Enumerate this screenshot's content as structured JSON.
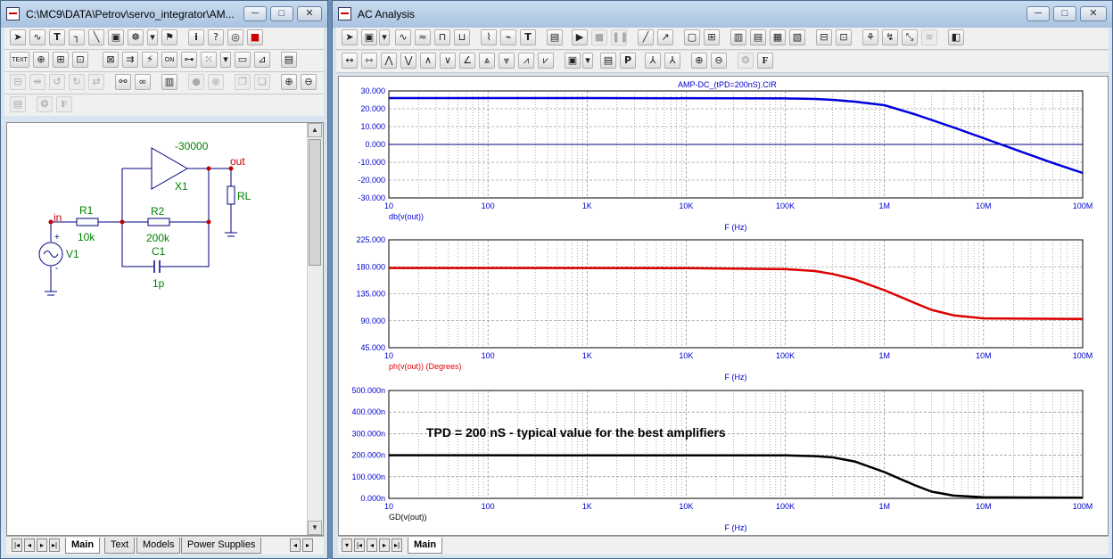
{
  "schematic_window": {
    "title": "C:\\MC9\\DATA\\Petrov\\servo_integrator\\AM...",
    "toolbar1": [
      "select-arrow",
      "wire",
      "text",
      "wire-orthogonal",
      "diagonal-line",
      "component",
      "info-tag",
      "probe",
      "flag",
      "info",
      "help",
      "plot",
      "stop-sim"
    ],
    "toolbar2": [
      "TEXT",
      "pin-connection",
      "grid-text",
      "attribute",
      "node-numbers",
      "current-flow",
      "power",
      "on-off",
      "pin-markers",
      "grid-dots",
      "dropdown",
      "border",
      "title-block",
      "properties"
    ],
    "toolbar3": [
      "rotate",
      "flip-x",
      "flip-y",
      "mirror",
      "find",
      "binoculars",
      "page-setup",
      "clear",
      "delete",
      "copy",
      "paste",
      "zoom-in",
      "zoom-out"
    ],
    "toolbar4": [
      "print-preview",
      "palette",
      "font-F"
    ],
    "labels": {
      "opamp_gain": "-30000",
      "opamp_name": "X1",
      "node_out": "out",
      "node_in": "in",
      "rl": "RL",
      "r1": "R1",
      "r1_val": "10k",
      "r2": "R2",
      "r2_val": "200k",
      "c1": "C1",
      "c1_val": "1p",
      "v1": "V1",
      "plus": "+",
      "minus": "-"
    },
    "tabs": [
      "Main",
      "Text",
      "Models",
      "Power Supplies"
    ],
    "active_tab": "Main"
  },
  "analysis_window": {
    "title": "AC Analysis",
    "tabs": [
      "Main"
    ],
    "active_tab": "Main",
    "plot_header": "AMP-DC_(tPD=200nS).CIR",
    "x_axis_label": "F (Hz)",
    "x_ticks": [
      "10",
      "100",
      "1K",
      "10K",
      "100K",
      "1M",
      "10M",
      "100M"
    ],
    "plots": [
      {
        "y_label": "db(v(out))",
        "y_ticks": [
          "30.000",
          "20.000",
          "10.000",
          "0.000",
          "-10.000",
          "-20.000",
          "-30.000"
        ],
        "ylim": [
          -30,
          30
        ],
        "color": "#0000dd",
        "curve": [
          [
            10,
            26
          ],
          [
            1000,
            26
          ],
          [
            100000,
            25.8
          ],
          [
            200000,
            25.5
          ],
          [
            300000,
            25
          ],
          [
            500000,
            24
          ],
          [
            1000000,
            22
          ],
          [
            2000000,
            17
          ],
          [
            5000000,
            9.5
          ],
          [
            10000000,
            3.5
          ],
          [
            20000000,
            -2.5
          ],
          [
            50000000,
            -10.4
          ],
          [
            100000000,
            -16
          ]
        ]
      },
      {
        "y_label": "ph(v(out)) (Degrees)",
        "y_ticks": [
          "225.000",
          "180.000",
          "135.000",
          "90.000",
          "45.000"
        ],
        "ylim": [
          45,
          225
        ],
        "color": "#dd0000",
        "curve": [
          [
            10,
            178
          ],
          [
            10000,
            177.8
          ],
          [
            100000,
            176
          ],
          [
            200000,
            173
          ],
          [
            300000,
            168
          ],
          [
            500000,
            159
          ],
          [
            1000000,
            141
          ],
          [
            2000000,
            120
          ],
          [
            3000000,
            108
          ],
          [
            5000000,
            99
          ],
          [
            10000000,
            94
          ],
          [
            100000000,
            93
          ]
        ]
      },
      {
        "y_label": "GD(v(out))",
        "y_ticks": [
          "500.000n",
          "400.000n",
          "300.000n",
          "200.000n",
          "100.000n",
          "0.000n"
        ],
        "ylim": [
          0,
          500
        ],
        "color": "#000000",
        "curve": [
          [
            10,
            200
          ],
          [
            100000,
            199
          ],
          [
            200000,
            196
          ],
          [
            300000,
            190
          ],
          [
            500000,
            171
          ],
          [
            1000000,
            122
          ],
          [
            2000000,
            62
          ],
          [
            3000000,
            31
          ],
          [
            5000000,
            13
          ],
          [
            10000000,
            5
          ],
          [
            100000000,
            3
          ]
        ]
      }
    ],
    "annotation": "TPD = 200 nS - typical value for the best amplifiers"
  }
}
